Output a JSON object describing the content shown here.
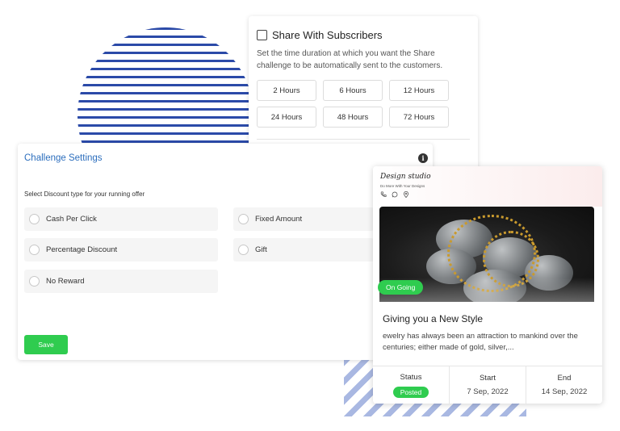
{
  "share": {
    "title": "Share With Subscribers",
    "description": "Set the time duration at which you want the Share challenge to be automatically sent to the customers.",
    "hours": [
      "2 Hours",
      "6 Hours",
      "12 Hours",
      "24 Hours",
      "48 Hours",
      "72 Hours"
    ]
  },
  "challenge": {
    "title": "Challenge Settings",
    "info_icon": "i",
    "discount_label": "Select Discount type for your running offer",
    "options": [
      "Cash Per Click",
      "Fixed Amount",
      "Percentage Discount",
      "Gift",
      "No Reward"
    ],
    "save_label": "Save"
  },
  "product": {
    "brand": "Design studio",
    "tagline": "Do More With Your Designs",
    "contact_icons": [
      "phone-icon",
      "whatsapp-icon",
      "location-icon"
    ],
    "badge": "On Going",
    "title": "Giving you a New Style",
    "description": "ewelry has always been an attraction to mankind over the centuries; either made of gold, silver,...",
    "status_label": "Status",
    "status_value": "Posted",
    "start_label": "Start",
    "start_value": "7 Sep, 2022",
    "end_label": "End",
    "end_value": "14 Sep, 2022"
  },
  "colors": {
    "accent_green": "#2fcc4f",
    "title_blue": "#2c6ebd",
    "stripe_blue": "#2b4aa8"
  }
}
